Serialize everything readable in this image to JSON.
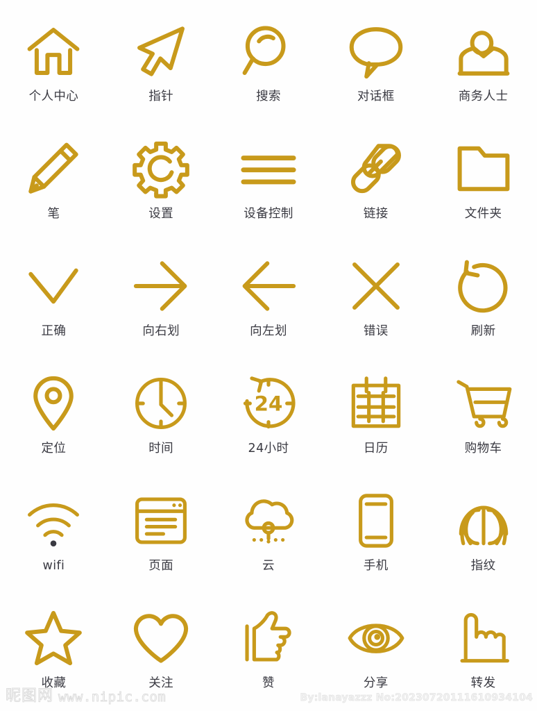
{
  "page": {
    "background_color": "#FEFEFE",
    "icon_color": "#C89A1B",
    "label_color": "#3A3A42",
    "columns": 5,
    "rows": 6,
    "total_icons": 30
  },
  "icons": [
    {
      "id": "home",
      "label": "个人中心",
      "icon_name": "home-icon"
    },
    {
      "id": "cursor",
      "label": "指针",
      "icon_name": "cursor-arrow-icon"
    },
    {
      "id": "search",
      "label": "搜索",
      "icon_name": "search-magnifier-icon"
    },
    {
      "id": "dialog",
      "label": "对话框",
      "icon_name": "speech-bubble-icon"
    },
    {
      "id": "business",
      "label": "商务人士",
      "icon_name": "business-person-icon"
    },
    {
      "id": "pen",
      "label": "笔",
      "icon_name": "pencil-icon"
    },
    {
      "id": "settings",
      "label": "设置",
      "icon_name": "gear-icon"
    },
    {
      "id": "device",
      "label": "设备控制",
      "icon_name": "hamburger-menu-icon"
    },
    {
      "id": "link",
      "label": "链接",
      "icon_name": "chain-link-icon"
    },
    {
      "id": "folder",
      "label": "文件夹",
      "icon_name": "folder-icon"
    },
    {
      "id": "correct",
      "label": "正确",
      "icon_name": "check-chevron-down-icon"
    },
    {
      "id": "swipe-right",
      "label": "向右划",
      "icon_name": "arrow-right-icon"
    },
    {
      "id": "swipe-left",
      "label": "向左划",
      "icon_name": "arrow-left-icon"
    },
    {
      "id": "error",
      "label": "错误",
      "icon_name": "close-cross-icon"
    },
    {
      "id": "refresh",
      "label": "刷新",
      "icon_name": "refresh-circular-arrow-icon"
    },
    {
      "id": "location",
      "label": "定位",
      "icon_name": "map-pin-icon"
    },
    {
      "id": "time",
      "label": "时间",
      "icon_name": "clock-icon"
    },
    {
      "id": "hours24",
      "label": "24小时",
      "icon_name": "24-hours-icon",
      "glyph_text": "24"
    },
    {
      "id": "calendar",
      "label": "日历",
      "icon_name": "calendar-icon"
    },
    {
      "id": "cart",
      "label": "购物车",
      "icon_name": "shopping-cart-icon"
    },
    {
      "id": "wifi",
      "label": "wifi",
      "icon_name": "wifi-icon"
    },
    {
      "id": "page",
      "label": "页面",
      "icon_name": "browser-page-icon"
    },
    {
      "id": "cloud",
      "label": "云",
      "icon_name": "cloud-icon"
    },
    {
      "id": "phone",
      "label": "手机",
      "icon_name": "mobile-phone-icon"
    },
    {
      "id": "fingerprint",
      "label": "指纹",
      "icon_name": "fingerprint-icon"
    },
    {
      "id": "favorite",
      "label": "收藏",
      "icon_name": "star-icon"
    },
    {
      "id": "follow",
      "label": "关注",
      "icon_name": "heart-icon"
    },
    {
      "id": "like",
      "label": "赞",
      "icon_name": "thumbs-up-icon"
    },
    {
      "id": "share",
      "label": "分享",
      "icon_name": "eye-icon"
    },
    {
      "id": "forward",
      "label": "转发",
      "icon_name": "pointing-hand-icon"
    }
  ],
  "watermark": {
    "site_name_cn": "昵图网",
    "site_url": "www.nipic.com",
    "credit": "By:lanayazzz No:20230720111610934104"
  }
}
